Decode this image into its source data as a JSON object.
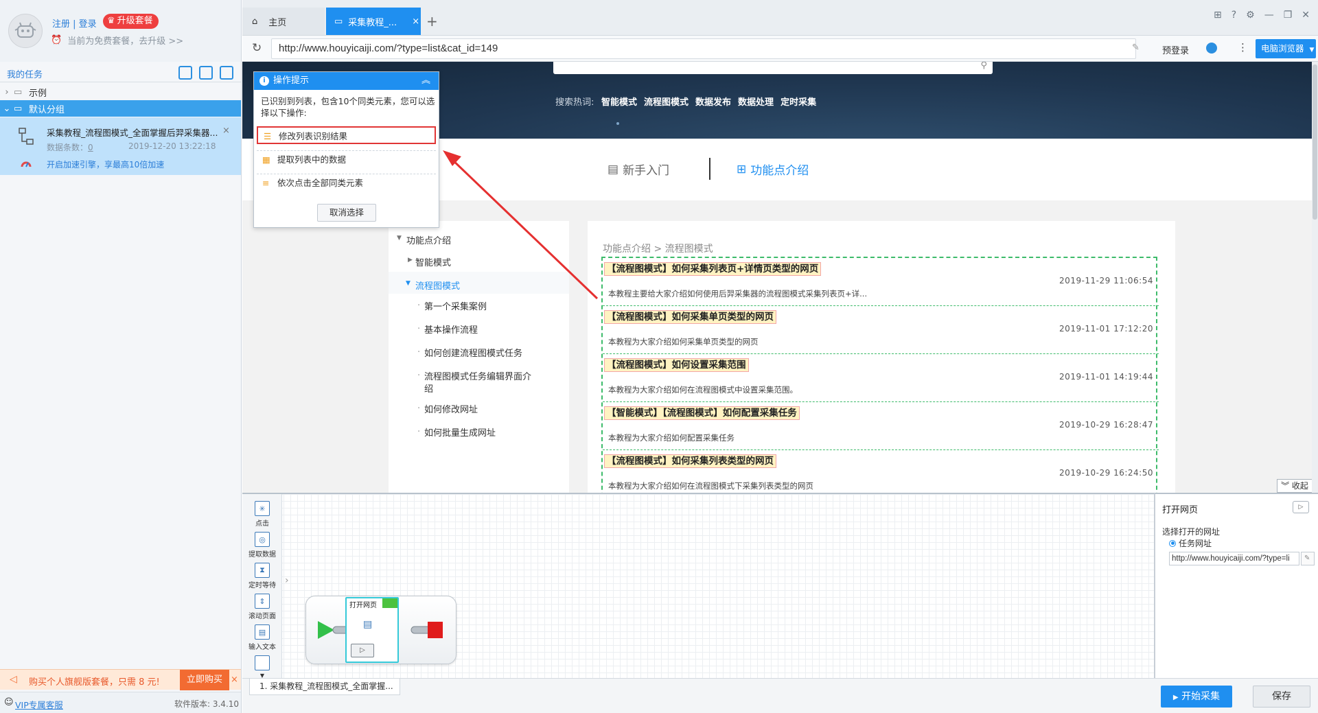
{
  "left_panel": {
    "login_link": "注册 | 登录",
    "upgrade_btn": "升级套餐",
    "plan_text": "当前为免费套餐，去升级 >>",
    "tasks_title": "我的任务",
    "groups": [
      {
        "label": "示例"
      },
      {
        "label": "默认分组"
      }
    ],
    "task": {
      "title": "采集教程_流程图模式_全面掌握后羿采集器...",
      "count_label": "数据条数：",
      "count": "0",
      "date": "2019-12-20 13:22:18",
      "speed_text": "开启加速引擎，享最高10倍加速"
    },
    "promo": {
      "text": "购买个人旗舰版套餐，只需 8 元!",
      "button": "立即购买"
    },
    "vip_link": "VIP专属客服",
    "version": "软件版本: 3.4.10"
  },
  "tabs": [
    {
      "label": "主页"
    },
    {
      "label": "采集教程_..."
    }
  ],
  "address": {
    "url": "http://www.houyicaiji.com/?type=list&cat_id=149",
    "prelogin": "预登录",
    "browser_btn": "电脑浏览器"
  },
  "webpage": {
    "hot_label": "搜索热词:",
    "hot_tags": [
      "智能模式",
      "流程图模式",
      "数据发布",
      "数据处理",
      "定时采集"
    ],
    "nav_beginner": "新手入门",
    "nav_features": "功能点介绍",
    "menu": [
      "功能点介绍",
      "智能模式",
      "流程图模式",
      "第一个采集案例",
      "基本操作流程",
      "如何创建流程图模式任务",
      "流程图模式任务编辑界面介",
      "绍",
      "如何修改网址",
      "如何批量生成网址"
    ],
    "breadcrumb": "功能点介绍 > 流程图模式",
    "articles": [
      {
        "title": "【流程图模式】如何采集列表页+详情页类型的网页",
        "date": "2019-11-29 11:06:54",
        "desc": "本教程主要给大家介绍如何使用后羿采集器的流程图模式采集列表页+详..."
      },
      {
        "title": "【流程图模式】如何采集单页类型的网页",
        "date": "2019-11-01 17:12:20",
        "desc": "本教程为大家介绍如何采集单页类型的网页"
      },
      {
        "title": "【流程图模式】如何设置采集范围",
        "date": "2019-11-01 14:19:44",
        "desc": "本教程为大家介绍如何在流程图模式中设置采集范围。"
      },
      {
        "title": "【智能模式】【流程图模式】如何配置采集任务",
        "date": "2019-10-29 16:28:47",
        "desc": "本教程为大家介绍如何配置采集任务"
      },
      {
        "title": "【流程图模式】如何采集列表类型的网页",
        "date": "2019-10-29 16:24:50",
        "desc": "本教程为大家介绍如何在流程图模式下采集列表类型的网页"
      }
    ],
    "collapse_btn": "收起"
  },
  "tip_popup": {
    "title": "操作提示",
    "desc": "已识别到列表，包含10个同类元素，您可以选择以下操作:",
    "options": [
      "修改列表识别结果",
      "提取列表中的数据",
      "依次点击全部同类元素"
    ],
    "cancel": "取消选择"
  },
  "workflow": {
    "tools": [
      "点击",
      "提取数据",
      "定时等待",
      "滚动页面",
      "输入文本"
    ],
    "node_label": "打开网页"
  },
  "props": {
    "title": "打开网页",
    "label": "选择打开的网址",
    "radio": "任务网址",
    "url": "http://www.houyicaiji.com/?type=li"
  },
  "bottom": {
    "task_tab": "1. 采集教程_流程图模式_全面掌握...",
    "start": "开始采集",
    "save": "保存"
  },
  "colors": {
    "accent": "#1f8ff0",
    "promo": "#f26b32",
    "highlight": "#e13535"
  }
}
